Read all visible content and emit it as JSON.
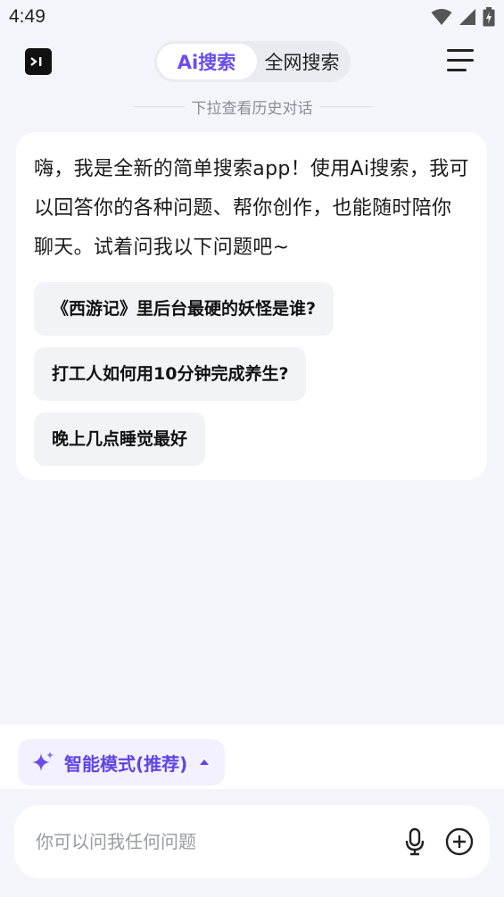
{
  "status_bar": {
    "time": "4:49"
  },
  "header": {
    "logo_text": ">I",
    "tabs": [
      {
        "label": "Ai搜索",
        "active": true
      },
      {
        "label": "全网搜索",
        "active": false
      }
    ]
  },
  "history_hint": "下拉查看历史对话",
  "welcome": {
    "message": "嗨，我是全新的简单搜索app！使用Ai搜索，我可以回答你的各种问题、帮你创作，也能随时陪你聊天。试着问我以下问题吧~",
    "suggestions": [
      "《西游记》里后台最硬的妖怪是谁?",
      "打工人如何用10分钟完成养生?",
      "晚上几点睡觉最好"
    ]
  },
  "mode_selector": {
    "label": "智能模式(推荐)"
  },
  "input": {
    "placeholder": "你可以问我任何问题",
    "value": ""
  },
  "colors": {
    "accent": "#6b4cf0",
    "background": "#f3f5fa",
    "card": "#ffffff",
    "chip_bg": "#f2f3f7"
  }
}
